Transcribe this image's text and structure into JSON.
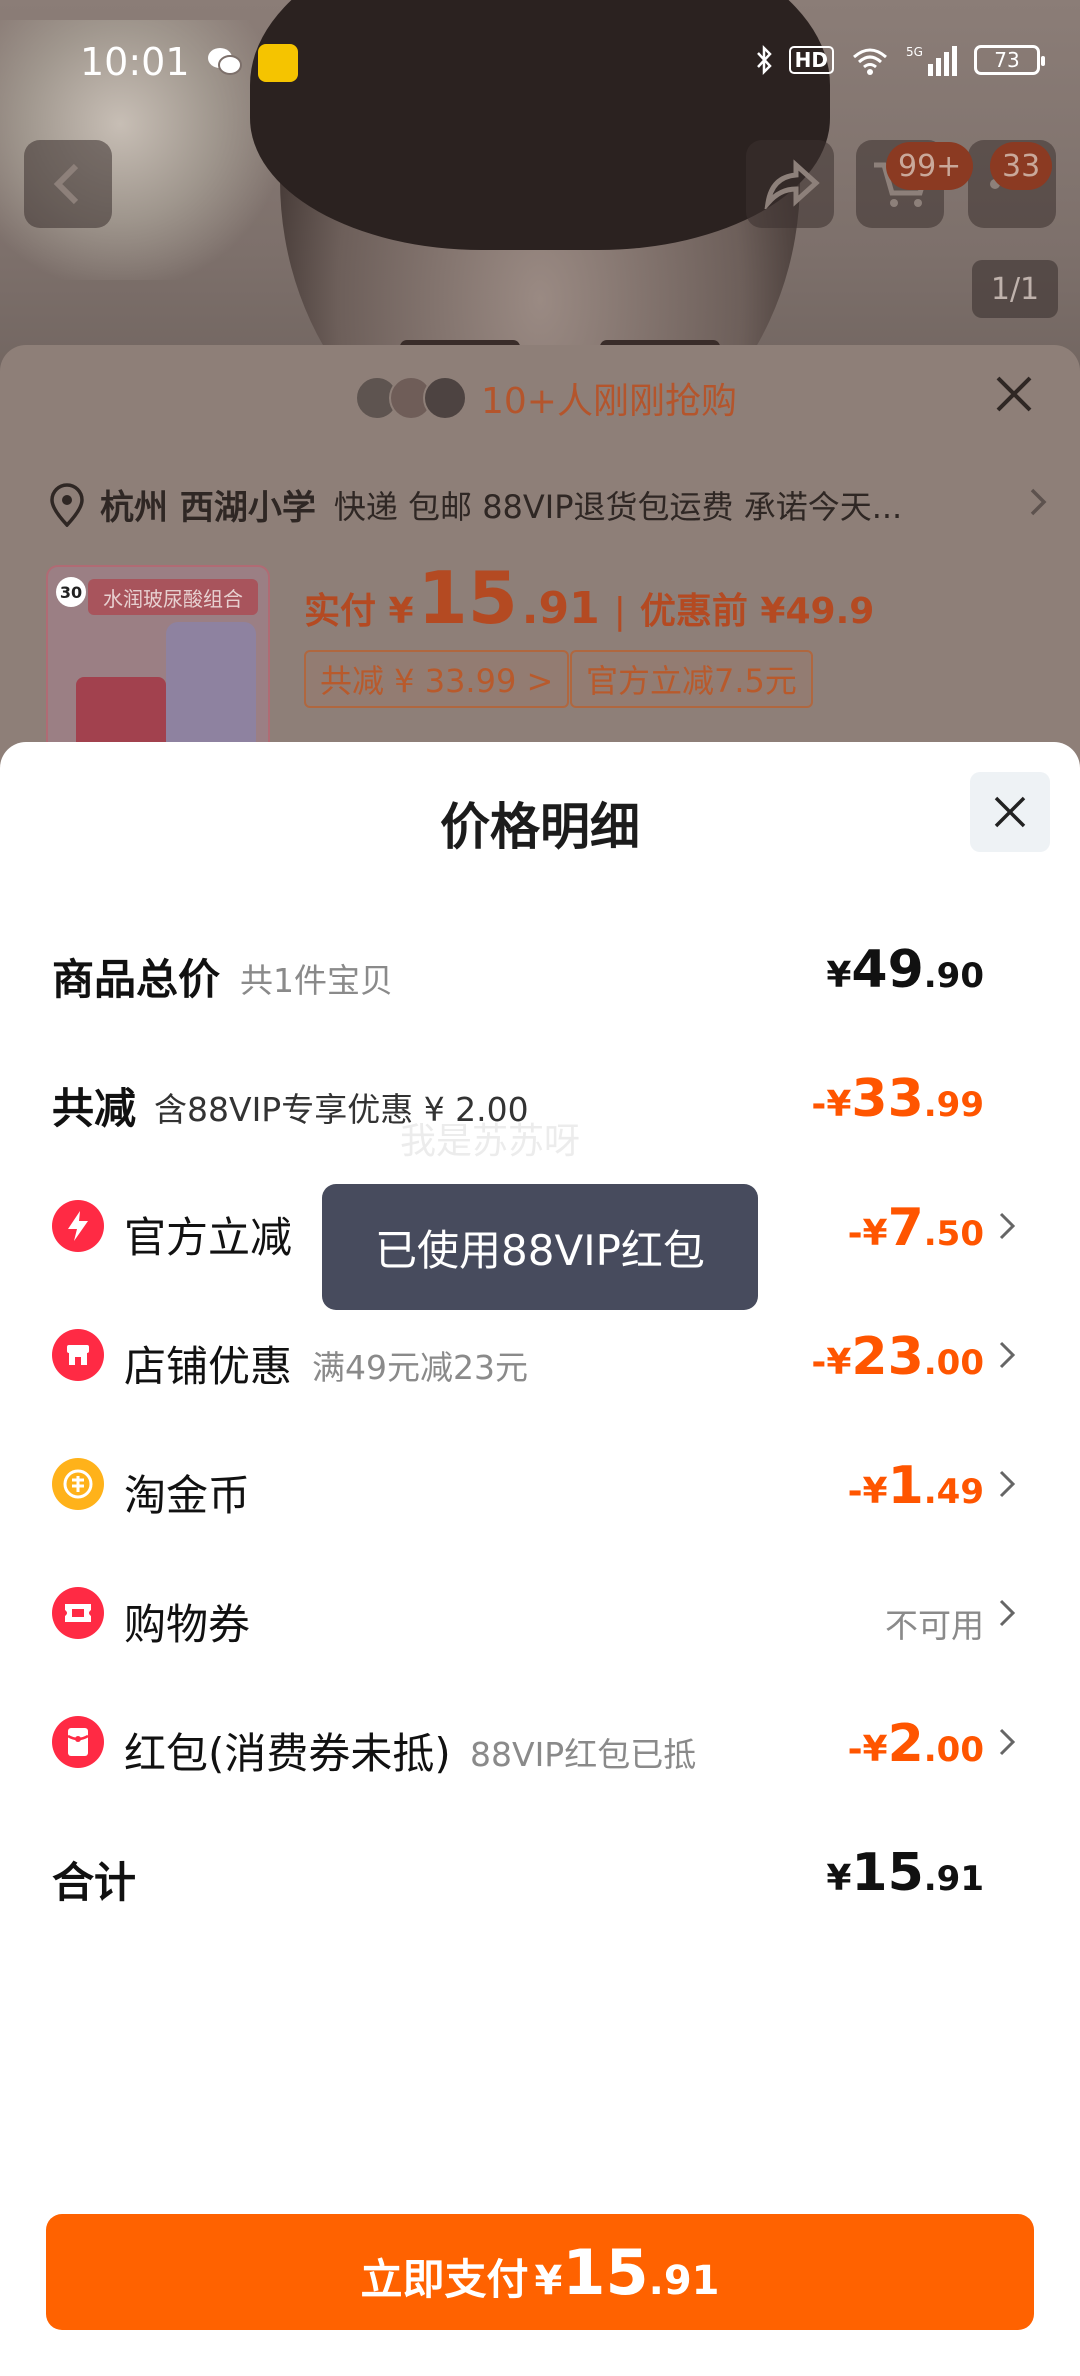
{
  "status_bar": {
    "time": "10:01",
    "network": "5G",
    "battery": "73"
  },
  "background": {
    "cart_badge": "99+",
    "msg_badge": "33",
    "image_pager": "1/1",
    "buyers_text": "10+人刚刚抢购",
    "address_city": "杭州 西湖小学",
    "address_info": "快递 包邮 88VIP退货包运费 承诺今天...",
    "product_label": "水润玻尿酸组合",
    "product_badge": "30",
    "price_paid_label": "实付 ¥",
    "price_paid_int": "15",
    "price_paid_dec": ".91",
    "price_sep": "|",
    "price_before": "优惠前 ¥49.9",
    "chip_total_reduce": "共减 ¥ 33.99 >",
    "chip_official": "官方立减7.5元"
  },
  "sheet": {
    "title": "价格明细",
    "rows": [
      {
        "name": "商品总价",
        "note": "共1件宝贝",
        "sym": "¥",
        "int": "49",
        "dec": ".90",
        "color": "#111111"
      },
      {
        "name": "共减",
        "note": "含88VIP专享优惠 ¥ 2.00",
        "sym": "-¥",
        "int": "33",
        "dec": ".99",
        "color": "#ff5500"
      },
      {
        "name": "官方立减",
        "note": "",
        "sym": "-¥",
        "int": "7",
        "dec": ".50",
        "color": "#ff5500",
        "icon": "lightning-icon"
      },
      {
        "name": "店铺优惠",
        "note": "满49元减23元",
        "sym": "-¥",
        "int": "23",
        "dec": ".00",
        "color": "#ff5500",
        "icon": "shop-icon"
      },
      {
        "name": "淘金币",
        "note": "",
        "sym": "-¥",
        "int": "1",
        "dec": ".49",
        "color": "#ff5500",
        "icon": "coin-icon"
      },
      {
        "name": "购物券",
        "note": "",
        "value": "不可用",
        "icon": "ticket-icon"
      },
      {
        "name": "红包(消费券未抵)",
        "note": "88VIP红包已抵",
        "sym": "-¥",
        "int": "2",
        "dec": ".00",
        "color": "#ff5500",
        "icon": "red-packet-icon"
      },
      {
        "name": "合计",
        "note": "",
        "sym": "¥",
        "int": "15",
        "dec": ".91",
        "color": "#111111"
      }
    ],
    "toast": "已使用88VIP红包",
    "watermark": "我是苏苏呀",
    "pay_button": {
      "label": "立即支付",
      "sym": "¥",
      "int": "15",
      "dec": ".91"
    }
  },
  "colors": {
    "accent": "#ff5500",
    "pay_button": "#ff6200",
    "toast_bg": "#474b5d"
  }
}
